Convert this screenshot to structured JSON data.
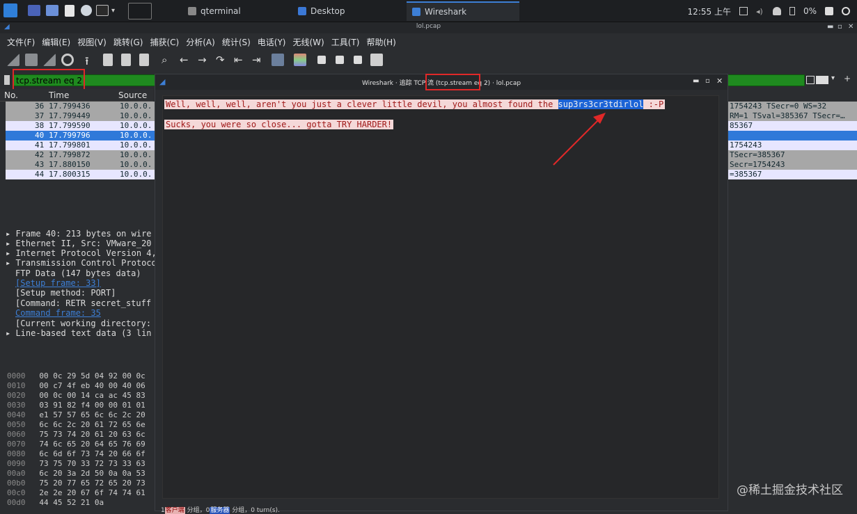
{
  "taskbar": {
    "windows": [
      {
        "label": "qterminal"
      },
      {
        "label": "Desktop"
      },
      {
        "label": "Wireshark"
      }
    ],
    "tray": {
      "time": "12:55 上午",
      "battery": "0%"
    }
  },
  "window": {
    "title": "lol.pcap"
  },
  "menu": [
    "文件(F)",
    "编辑(E)",
    "视图(V)",
    "跳转(G)",
    "捕获(C)",
    "分析(A)",
    "统计(S)",
    "电话(Y)",
    "无线(W)",
    "工具(T)",
    "帮助(H)"
  ],
  "filter": {
    "text": "tcp.stream eq 2"
  },
  "packet_list": {
    "headers": {
      "no": "No.",
      "time": "Time",
      "source": "Source"
    },
    "rows": [
      {
        "no": "36",
        "time": "17.799436",
        "src": "10.0.0.",
        "info": "1754243 TSecr=0 WS=32"
      },
      {
        "no": "37",
        "time": "17.799449",
        "src": "10.0.0.",
        "info": "RM=1 TSval=385367 TSecr=…"
      },
      {
        "no": "38",
        "time": "17.799590",
        "src": "10.0.0.",
        "info": "85367"
      },
      {
        "no": "40",
        "time": "17.799796",
        "src": "10.0.0.",
        "info": ""
      },
      {
        "no": "41",
        "time": "17.799801",
        "src": "10.0.0.",
        "info": "1754243"
      },
      {
        "no": "42",
        "time": "17.799872",
        "src": "10.0.0.",
        "info": "TSecr=385367"
      },
      {
        "no": "43",
        "time": "17.880150",
        "src": "10.0.0.",
        "info": "Secr=1754243"
      },
      {
        "no": "44",
        "time": "17.800315",
        "src": "10.0.0.",
        "info": "=385367"
      }
    ]
  },
  "details": [
    "Frame 40: 213 bytes on wire",
    "Ethernet II, Src: VMware_20",
    "Internet Protocol Version 4,",
    "Transmission Control Protoco",
    "FTP Data (147 bytes data)",
    "[Setup frame: 33]",
    "[Setup method: PORT]",
    "[Command: RETR secret_stuff",
    "Command frame: 35",
    "[Current working directory:",
    "Line-based text data (3 lin"
  ],
  "hex": [
    {
      "off": "0000",
      "bytes": "00 0c 29 5d 04 92 00 0c"
    },
    {
      "off": "0010",
      "bytes": "00 c7 4f eb 40 00 40 06"
    },
    {
      "off": "0020",
      "bytes": "00 0c 00 14 ca ac 45 83"
    },
    {
      "off": "0030",
      "bytes": "03 91 82 f4 00 00 01 01"
    },
    {
      "off": "0040",
      "bytes": "e1 57 57 65 6c 6c 2c 20"
    },
    {
      "off": "0050",
      "bytes": "6c 6c 2c 20 61 72 65 6e"
    },
    {
      "off": "0060",
      "bytes": "75 73 74 20 61 20 63 6c"
    },
    {
      "off": "0070",
      "bytes": "74 6c 65 20 64 65 76 69"
    },
    {
      "off": "0080",
      "bytes": "6c 6d 6f 73 74 20 66 6f"
    },
    {
      "off": "0090",
      "bytes": "73 75 70 33 72 73 33 63"
    },
    {
      "off": "00a0",
      "bytes": "6c 20 3a 2d 50 0a 0a 53"
    },
    {
      "off": "00b0",
      "bytes": "75 20 77 65 72 65 20 73"
    },
    {
      "off": "00c0",
      "bytes": "2e 2e 20 67 6f 74 74 61"
    },
    {
      "off": "00d0",
      "bytes": "44 45 52 21 0a"
    }
  ],
  "dialog": {
    "title_prefix": "Wireshark · 追踪 TCP 流",
    "title_filter": "(tcp.stream eq 2)",
    "title_file": "· lol.pcap",
    "line1_pre": "Well, well, well, aren't you just a clever little devil, you almost found the ",
    "line1_hl": "sup3rs3cr3tdirlol",
    "line1_post": " :-P",
    "line2": "Sucks, you were so close... gotta TRY HARDER!",
    "footer": {
      "n1": "1",
      "client_label": "客户端",
      "mid1": " 分组，",
      "n2": "0",
      "server_label": "服务器",
      "mid2": " 分组，",
      "turns": "0 turn(s)."
    }
  },
  "watermark": "@稀土掘金技术社区"
}
